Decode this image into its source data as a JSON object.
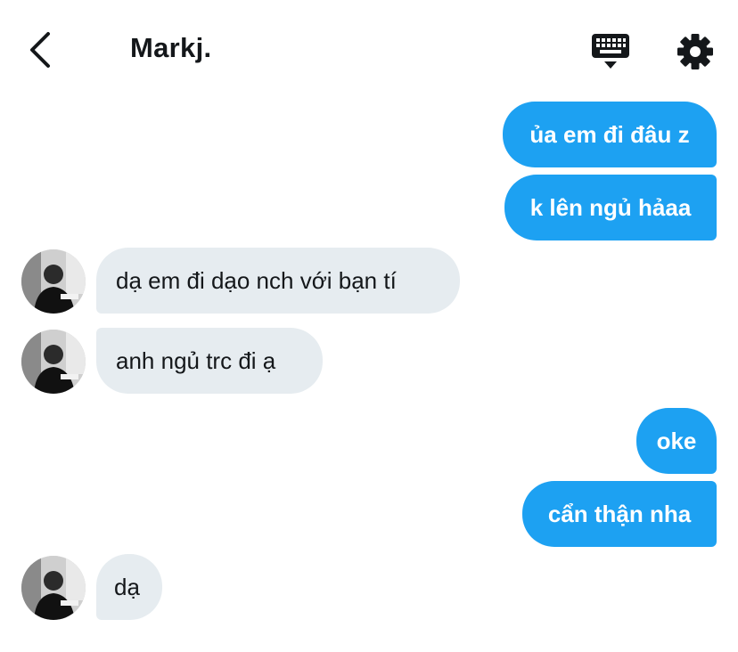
{
  "header": {
    "title": "Markj.",
    "back_icon": "chevron-left-icon",
    "keyboard_icon": "keyboard-icon",
    "settings_icon": "gear-icon"
  },
  "messages": [
    {
      "direction": "outgoing",
      "text": "ủa em đi đâu z"
    },
    {
      "direction": "outgoing",
      "text": "k lên ngủ hảaa"
    },
    {
      "direction": "incoming",
      "text": "dạ em đi dạo nch với bạn tí"
    },
    {
      "direction": "incoming",
      "text": "anh ngủ trc đi ạ"
    },
    {
      "direction": "outgoing",
      "text": "oke"
    },
    {
      "direction": "outgoing",
      "text": "cẩn thận nha"
    },
    {
      "direction": "incoming",
      "text": "dạ"
    }
  ],
  "colors": {
    "outgoing_bubble": "#1da1f2",
    "incoming_bubble": "#e6ecf0",
    "text_dark": "#14171a"
  }
}
